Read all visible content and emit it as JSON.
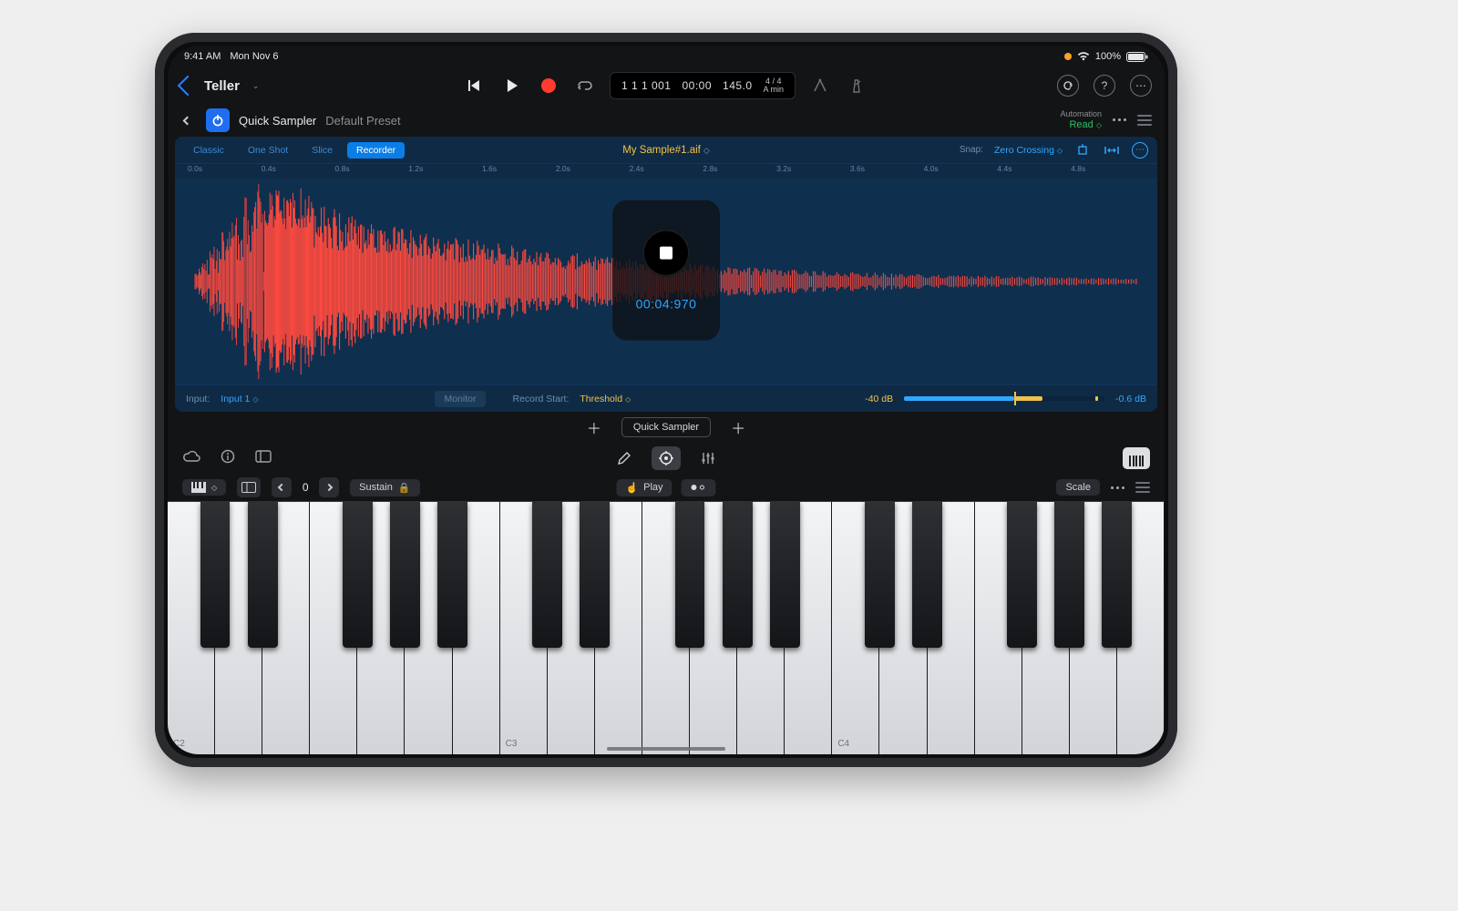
{
  "status": {
    "time": "9:41 AM",
    "date": "Mon Nov 6",
    "battery": "100%"
  },
  "topbar": {
    "project": "Teller"
  },
  "display": {
    "bars": "1 1 1 001",
    "time": "00:00",
    "tempo": "145.0",
    "sig_top": "4 / 4",
    "sig_bottom": "A min"
  },
  "instr": {
    "name": "Quick Sampler",
    "preset": "Default Preset",
    "automation_label": "Automation",
    "automation_value": "Read"
  },
  "sampler": {
    "modes": [
      "Classic",
      "One Shot",
      "Slice",
      "Recorder"
    ],
    "active_mode": "Recorder",
    "sample_name": "My Sample#1.aif",
    "snap_label": "Snap:",
    "snap_value": "Zero Crossing",
    "ruler": [
      "0.0s",
      "0.4s",
      "0.8s",
      "1.2s",
      "1.6s",
      "2.0s",
      "2.4s",
      "2.8s",
      "3.2s",
      "3.6s",
      "4.0s",
      "4.4s",
      "4.8s"
    ],
    "rec_time": "00:04:970",
    "input_label": "Input:",
    "input_value": "Input 1",
    "monitor": "Monitor",
    "rec_start_label": "Record Start:",
    "rec_start_value": "Threshold",
    "db_left": "-40 dB",
    "db_right": "-0.6 dB"
  },
  "chiprow": {
    "chip": "Quick Sampler"
  },
  "kb": {
    "octave": "0",
    "sustain": "Sustain",
    "play": "Play",
    "scale": "Scale",
    "labels": {
      "c2": "C2",
      "c3": "C3",
      "c4": "C4"
    }
  }
}
